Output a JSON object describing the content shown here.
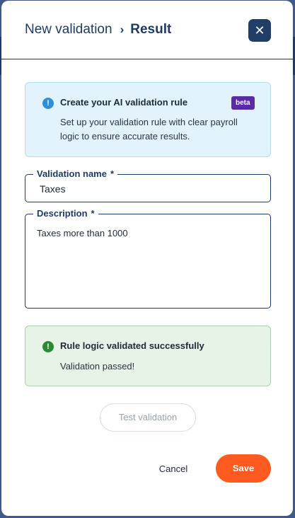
{
  "header": {
    "breadcrumb_parent": "New validation",
    "breadcrumb_separator": "›",
    "breadcrumb_current": "Result",
    "close_glyph": "✕"
  },
  "info": {
    "icon_glyph": "!",
    "title": "Create your AI validation rule",
    "badge": "beta",
    "text": "Set up your validation rule with clear payroll logic to ensure accurate results."
  },
  "form": {
    "name_label": "Validation name",
    "name_required": "*",
    "name_value": "Taxes",
    "description_label": "Description",
    "description_required": "*",
    "description_value": "Taxes more than 1000"
  },
  "result": {
    "icon_glyph": "!",
    "title": "Rule logic validated successfully",
    "text": "Validation passed!"
  },
  "actions": {
    "test_label": "Test validation",
    "cancel_label": "Cancel",
    "save_label": "Save"
  },
  "colors": {
    "primary_dark": "#213e66",
    "accent_orange": "#ff5a1f",
    "info_blue": "#2d8fe0",
    "success_green": "#2c8a34",
    "beta_purple": "#5b2aa8"
  }
}
